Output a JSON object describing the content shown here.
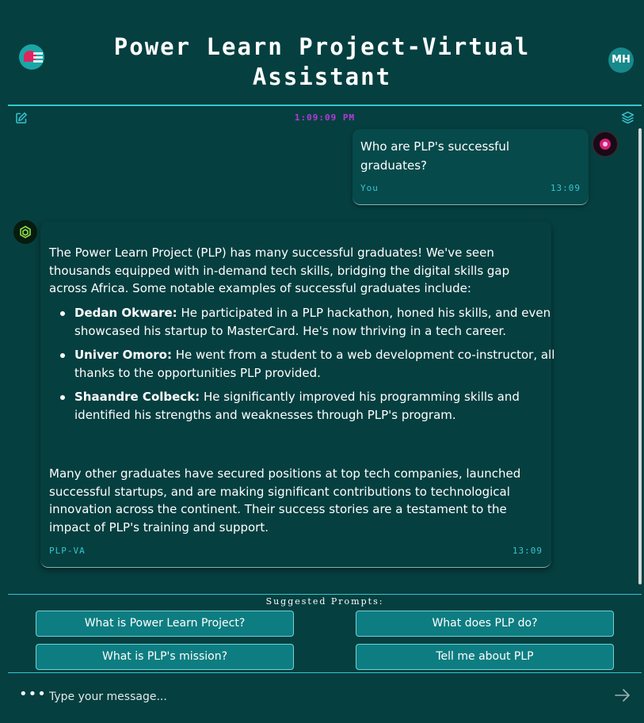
{
  "header": {
    "title": "Power Learn Project-Virtual Assistant",
    "user_initials": "MH"
  },
  "toolbar": {
    "edit_icon": "edit-icon",
    "layers_icon": "layers-icon",
    "timestamp": "1:09:09 PM"
  },
  "messages": [
    {
      "sender": "You",
      "time": "13:09",
      "text": "Who are PLP's successful graduates?"
    },
    {
      "sender": "PLP-VA",
      "time": "13:09",
      "intro": "The Power Learn Project (PLP) has many successful graduates! We've seen thousands equipped with in-demand tech skills, bridging the digital skills gap across Africa. Some notable examples of successful graduates include:",
      "items": [
        {
          "name": "Dedan Okware:",
          "text": " He participated in a PLP hackathon, honed his skills, and even showcased his startup to MasterCard. He's now thriving in a tech career."
        },
        {
          "name": "Univer Omoro:",
          "text": " He went from a student to a web development co-instructor, all thanks to the opportunities PLP provided."
        },
        {
          "name": "Shaandre Colbeck:",
          "text": " He significantly improved his programming skills and identified his strengths and weaknesses through PLP's program."
        }
      ],
      "outro": "Many other graduates have secured positions at top tech companies, launched successful startups, and are making significant contributions to technological innovation across the continent. Their success stories are a testament to the impact of PLP's training and support."
    }
  ],
  "suggested": {
    "title": "Suggested Prompts:",
    "prompts": [
      "What is Power Learn Project?",
      "What does PLP do?",
      "What is PLP's mission?",
      "Tell me about PLP"
    ]
  },
  "composer": {
    "placeholder": "Type your message...",
    "more_icon": "more-icon",
    "send_icon": "send-icon"
  },
  "colors": {
    "background": "#063f40",
    "accent": "#35c5d0",
    "button": "#0e7d81",
    "timestamp": "#b33bd6"
  }
}
